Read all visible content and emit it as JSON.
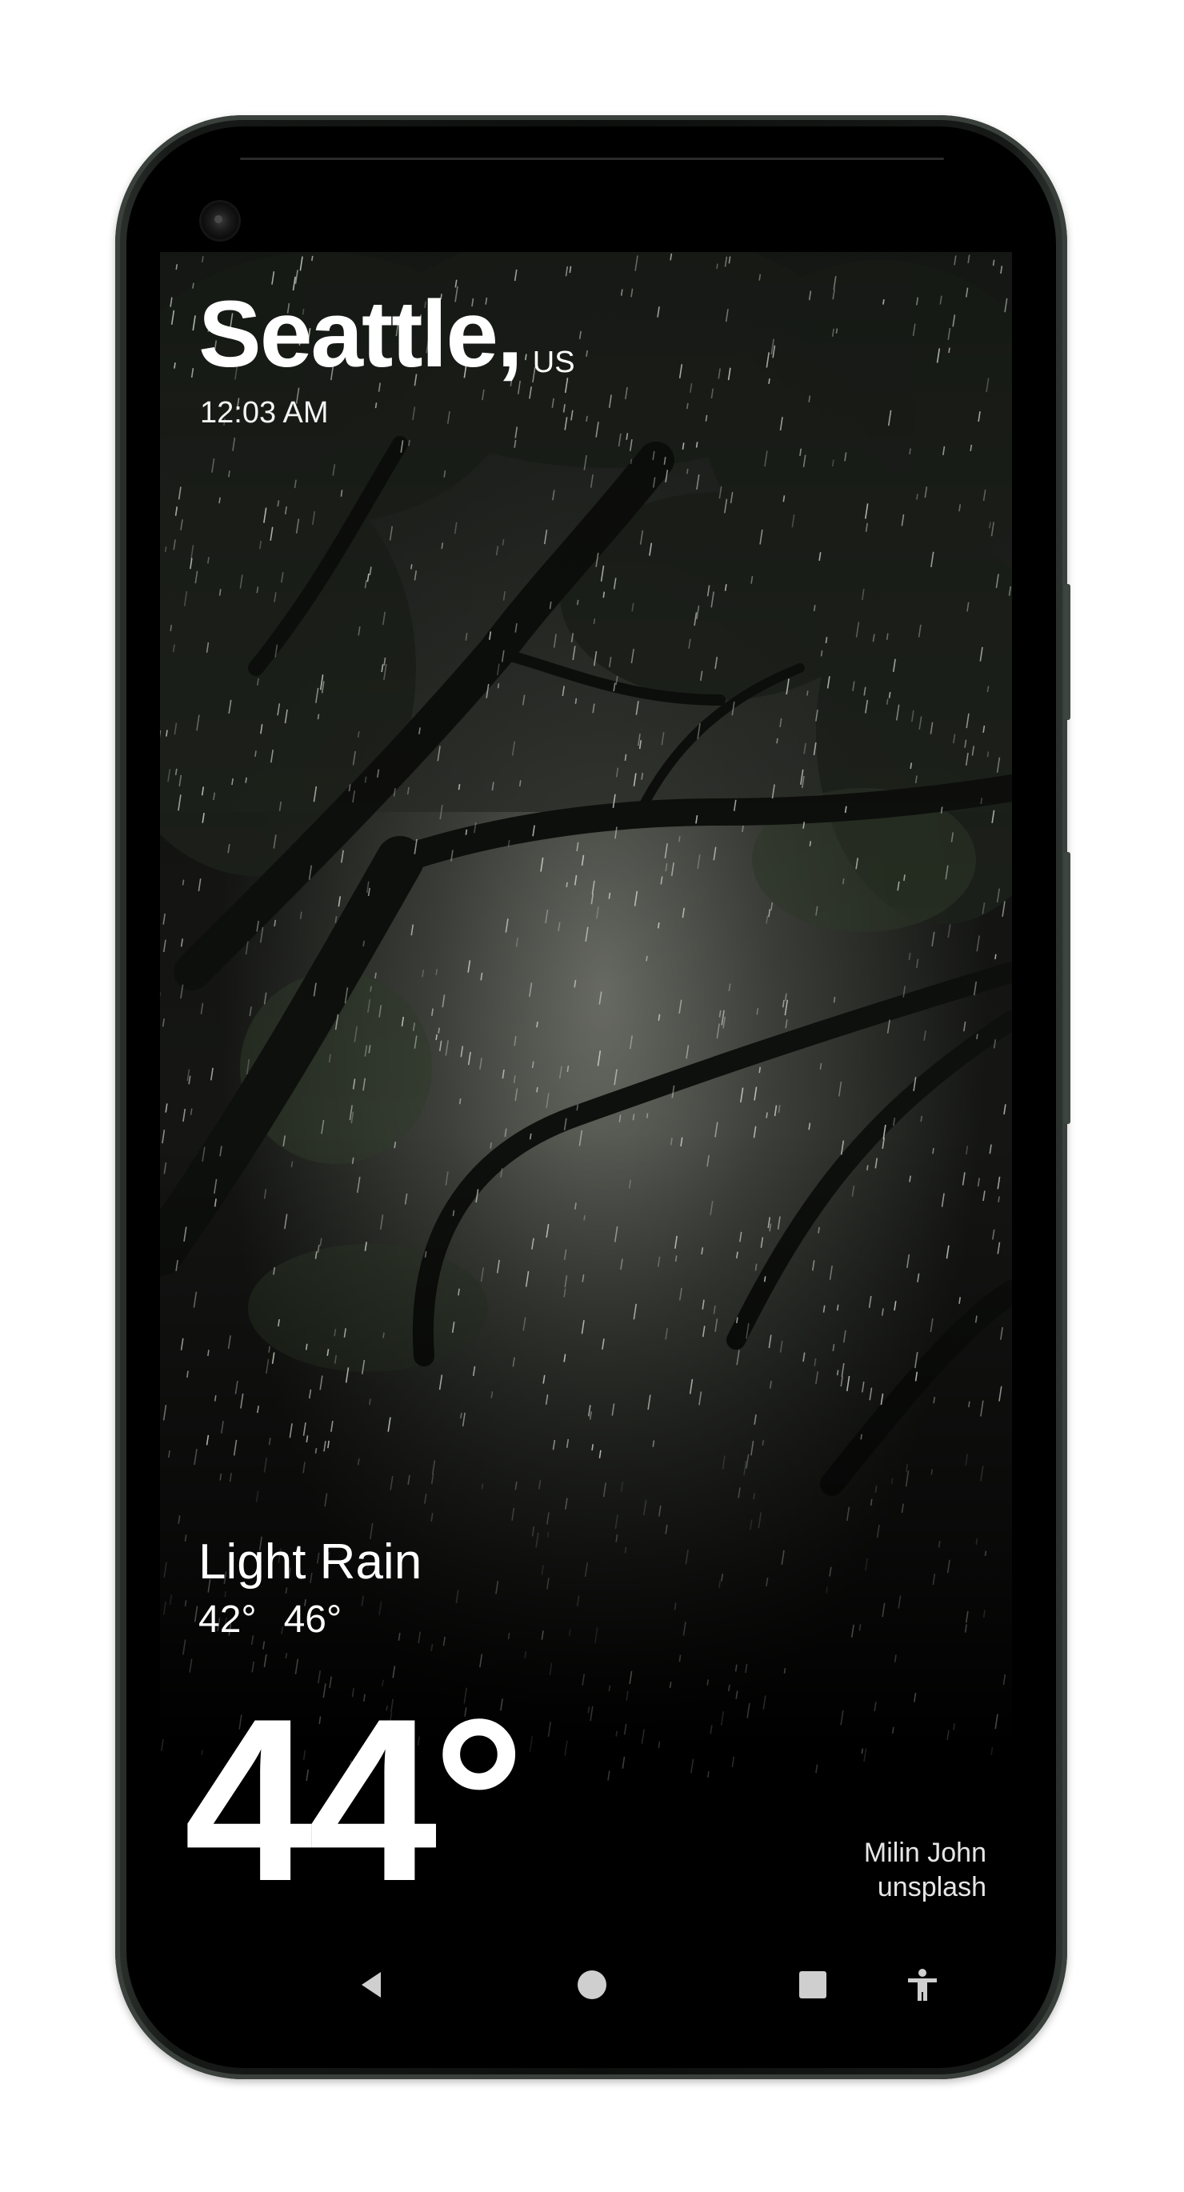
{
  "weather": {
    "city": "Seattle,",
    "country": "US",
    "time": "12:03 AM",
    "condition": "Light Rain",
    "low": "42°",
    "high": "46°",
    "temperature": "44°"
  },
  "photo_credit": {
    "author": "Milin John",
    "source": "unsplash"
  },
  "navbar": {
    "icons": [
      "back-icon",
      "home-icon",
      "recents-icon",
      "accessibility-icon"
    ]
  },
  "colors": {
    "text": "#ffffff",
    "background": "#000000",
    "phone_frame": "#161917"
  }
}
